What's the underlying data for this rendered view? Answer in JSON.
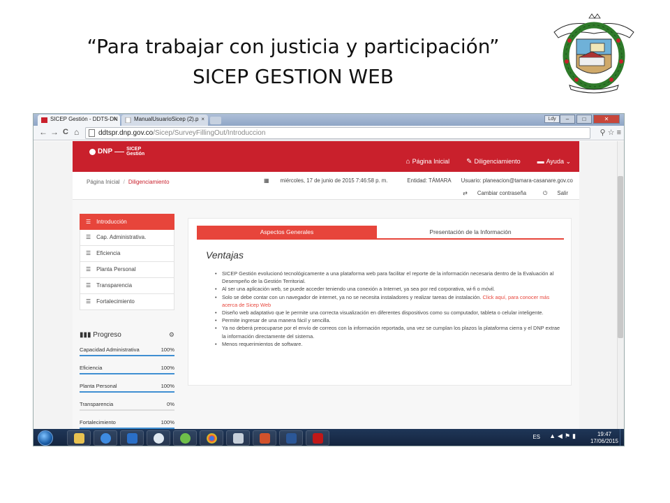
{
  "slide": {
    "title_line1": "“Para trabajar con justicia y participación”",
    "title_line2": "SICEP GESTION WEB"
  },
  "browser": {
    "tabs": [
      {
        "label": "SICEP Gestión - DDTS-DN",
        "close": "×"
      },
      {
        "label": "ManualUsuarioSicep (2).p",
        "close": "×"
      }
    ],
    "window_user": "Ldy",
    "window_buttons": [
      "–",
      "□",
      "✕"
    ],
    "url_host": "ddtspr.dnp.gov.co",
    "url_path": "/Sicep/SurveyFillingOut/Introduccion",
    "nav_back": "←",
    "nav_forward": "→",
    "nav_reload": "C",
    "nav_home": "⌂",
    "toolbar_right": "⚲ ☆ ≡"
  },
  "app": {
    "logo_dnp": "DNP",
    "logo_product_line1": "SICEP",
    "logo_product_line2": "Gestión",
    "nav": [
      {
        "icon": "⌂",
        "label": "Página Inicial"
      },
      {
        "icon": "✎",
        "label": "Diligenciamiento"
      },
      {
        "icon": "▬",
        "label": "Ayuda ⌄"
      }
    ],
    "breadcrumb": {
      "home": "Página Inicial",
      "sep": "/",
      "current": "Diligenciamiento"
    },
    "date": "miércoles, 17 de junio de 2015 7:46:58 p. m.",
    "entity": "Entidad: TÁMARA",
    "user": "Usuario: planeacion@tamara-casanare.gov.co",
    "change_password": "Cambiar contraseña",
    "logout": "Salir",
    "sidebar": [
      {
        "label": "Introducción",
        "active": true
      },
      {
        "label": "Cap. Administrativa.",
        "active": false
      },
      {
        "label": "Eficiencia",
        "active": false
      },
      {
        "label": "Planta Personal",
        "active": false
      },
      {
        "label": "Transparencia",
        "active": false
      },
      {
        "label": "Fortalecimiento",
        "active": false
      }
    ],
    "progress": {
      "title": "Progreso",
      "rows": [
        {
          "label": "Capacidad Administrativa",
          "value": "100%",
          "fraction": 1.0
        },
        {
          "label": "Eficiencia",
          "value": "100%",
          "fraction": 1.0
        },
        {
          "label": "Planta Personal",
          "value": "100%",
          "fraction": 1.0
        },
        {
          "label": "Transparencia",
          "value": "0%",
          "fraction": 0.0
        },
        {
          "label": "Fortalecimiento",
          "value": "100%",
          "fraction": 1.0
        }
      ]
    },
    "content": {
      "tab_active": "Aspectos Generales",
      "tab_inactive": "Presentación de la Información",
      "heading": "Ventajas",
      "items": [
        "SICEP Gestión evolucionó tecnológicamente a una plataforma web para facilitar el reporte de la información necesaria dentro de la Evaluación al Desempeño de la Gestión Territorial.",
        "Al ser una aplicación web, se puede acceder teniendo una conexión a Internet, ya sea por red corporativa, wi-fi o móvil.",
        "Solo se debe contar con un navegador de internet, ya no se necesita instaladores y realizar tareas de instalación.",
        "Diseño web adaptativo que le permite una correcta visualización en diferentes dispositivos como su computador, tableta o celular inteligente.",
        "Permite ingresar de una manera fácil y sencilla.",
        "Ya no deberá preocuparse por el envío de correos con la información reportada, una vez se cumplan los plazos la plataforma cierra y el DNP extrae la información directamente del sistema.",
        "Menos requerimientos de software."
      ],
      "link_text": "Click aquí, para conocer más acerca de Sicep Web"
    }
  },
  "taskbar": {
    "lang": "ES",
    "time": "19:47",
    "date": "17/06/2015"
  },
  "colors": {
    "brand_red": "#c9202c",
    "accent_red": "#e7453b",
    "progress_blue": "#3f8fd2"
  }
}
